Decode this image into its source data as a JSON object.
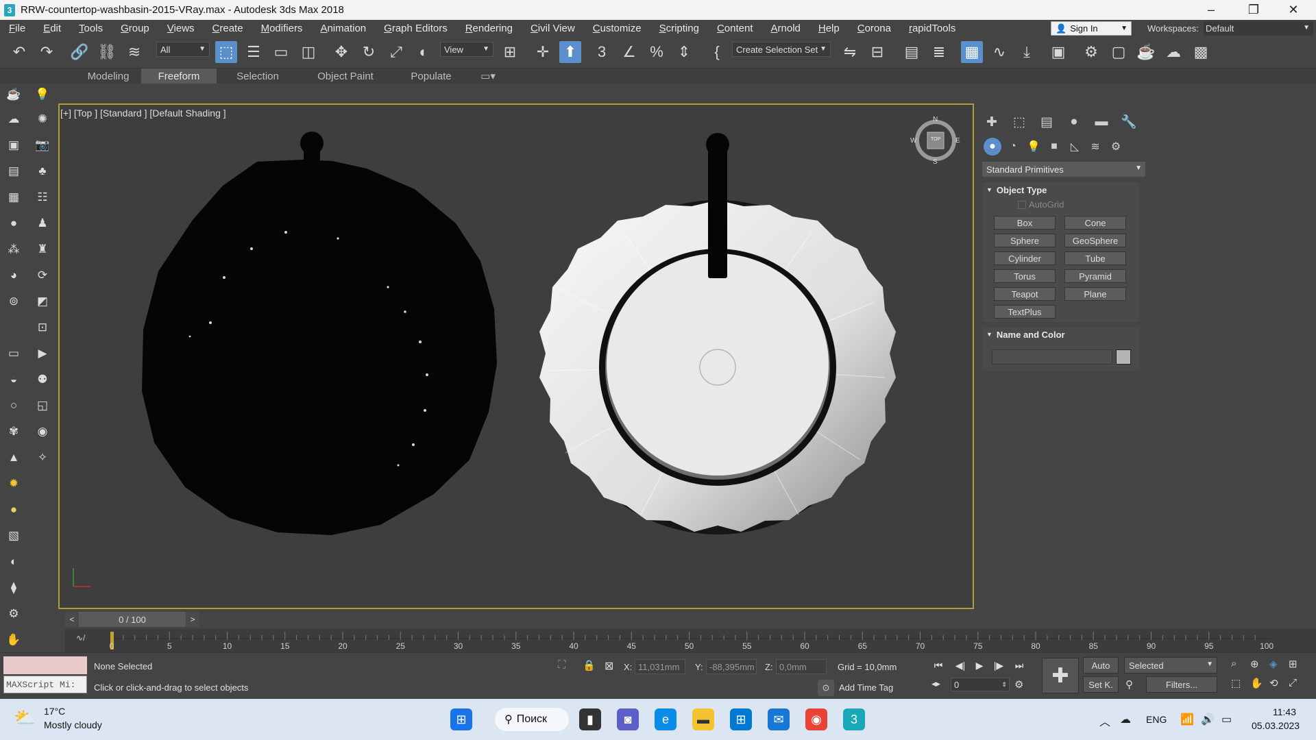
{
  "window": {
    "title": "RRW-countertop-washbasin-2015-VRay.max - Autodesk 3ds Max 2018",
    "app_icon_glyph": "3"
  },
  "menu": [
    "File",
    "Edit",
    "Tools",
    "Group",
    "Views",
    "Create",
    "Modifiers",
    "Animation",
    "Graph Editors",
    "Rendering",
    "Civil View",
    "Customize",
    "Scripting",
    "Content",
    "Arnold",
    "Help",
    "Corona",
    "rapidTools"
  ],
  "account": {
    "sign_in": "Sign In",
    "workspaces_label": "Workspaces:",
    "workspace_value": "Default"
  },
  "toolbar": {
    "selection_filter": "All",
    "reference_coord": "View",
    "selection_set": "Create Selection Set"
  },
  "ribbon_tabs": [
    "Modeling",
    "Freeform",
    "Selection",
    "Object Paint",
    "Populate"
  ],
  "viewport": {
    "label": "[+] [Top ] [Standard ] [Default Shading ]",
    "viewcube_face": "TOP",
    "compass": {
      "n": "N",
      "s": "S",
      "e": "E",
      "w": "W"
    }
  },
  "command_panel": {
    "category": "Standard Primitives",
    "object_type_title": "Object Type",
    "autogrid_label": "AutoGrid",
    "primitives": [
      "Box",
      "Cone",
      "Sphere",
      "GeoSphere",
      "Cylinder",
      "Tube",
      "Torus",
      "Pyramid",
      "Teapot",
      "Plane",
      "TextPlus"
    ],
    "name_color_title": "Name and Color",
    "object_color": "#b4b4b4"
  },
  "timeline": {
    "frame_display": "0 / 100",
    "ticks": [
      "0",
      "5",
      "10",
      "15",
      "20",
      "25",
      "30",
      "35",
      "40",
      "45",
      "50",
      "55",
      "60",
      "65",
      "70",
      "75",
      "80",
      "85",
      "90",
      "95",
      "100"
    ]
  },
  "status": {
    "maxscript_placeholder": "MAXScript Mi:",
    "selection_status": "None Selected",
    "prompt": "Click or click-and-drag to select objects",
    "x_label": "X:",
    "x_value": "11,031mm",
    "y_label": "Y:",
    "y_value": "-88,395mm",
    "z_label": "Z:",
    "z_value": "0,0mm",
    "grid": "Grid = 10,0mm",
    "add_time_tag": "Add Time Tag",
    "auto_key": "Auto",
    "set_key": "Set K.",
    "key_filter": "Selected",
    "filters": "Filters...",
    "current_frame": "0"
  },
  "taskbar": {
    "weather_temp": "17°C",
    "weather_desc": "Mostly cloudy",
    "search_label": "Поиск",
    "language": "ENG",
    "time": "11:43",
    "date": "05.03.2023"
  },
  "colors": {
    "viewport_border": "#b39a3a",
    "active_blue": "#5b8fc9",
    "taskbar": "#dce6f2",
    "listener_pink": "#e8c9cc"
  }
}
